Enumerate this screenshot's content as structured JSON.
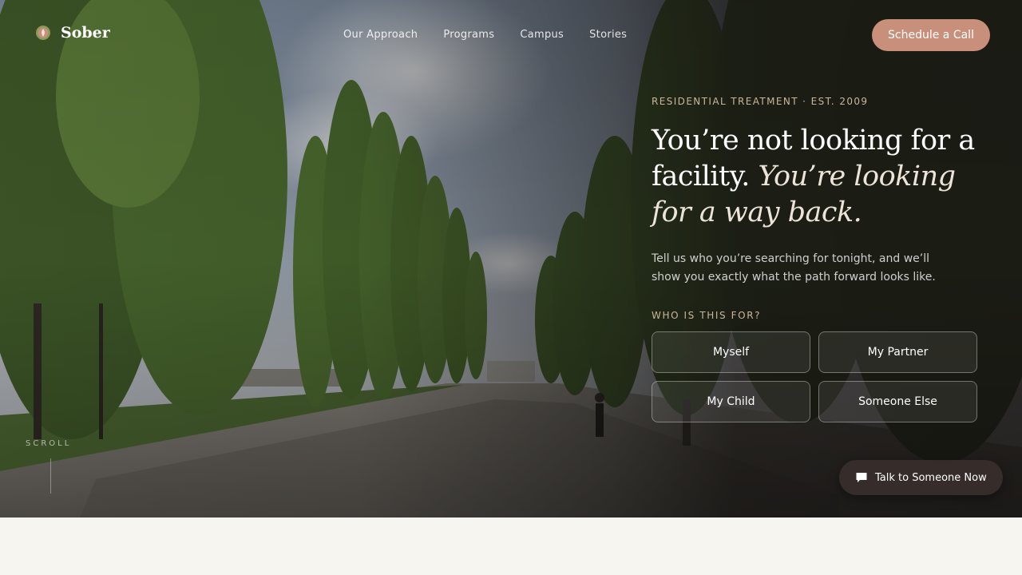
{
  "brand": {
    "name": "Sober",
    "icon": "flame-leaf-icon"
  },
  "nav": {
    "links": [
      "Our Approach",
      "Programs",
      "Campus",
      "Stories"
    ]
  },
  "cta": {
    "label": "Schedule a Call"
  },
  "hero": {
    "eyebrow": "RESIDENTIAL TREATMENT · EST. 2009",
    "headline_plain": "You’re not looking for a facility.",
    "headline_italic": "You’re looking for a way back.",
    "subtext": "Tell us who you’re searching for tonight, and we’ll show you exactly what the path forward looks like.",
    "question": "WHO IS THIS FOR?",
    "choices": [
      "Myself",
      "My Partner",
      "My Child",
      "Someone Else"
    ]
  },
  "scroll": {
    "label": "SCROLL"
  },
  "chat": {
    "label": "Talk to Someone Now",
    "icon": "chat-bubble-icon"
  },
  "colors": {
    "accent": "#c8907a",
    "eyebrow": "#c9b69a",
    "page_background": "#f7f5f0"
  }
}
